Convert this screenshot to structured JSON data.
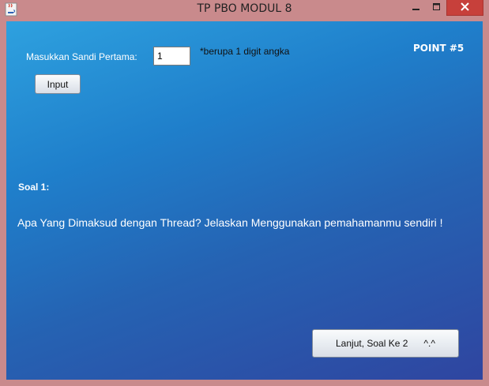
{
  "window": {
    "title": "TP PBO MODUL 8",
    "app_icon": "java-cup-icon",
    "controls": {
      "minimize_icon": "minimize-icon",
      "maximize_icon": "maximize-icon",
      "close_icon": "close-icon"
    },
    "close_color": "#c7403b"
  },
  "form": {
    "prompt_label": "Masukkan Sandi Pertama:",
    "sandi_value": "1",
    "hint": "*berupa 1 digit angka",
    "point_label": "POINT #5",
    "input_button": "Input"
  },
  "question": {
    "heading": "Soal 1:",
    "text": "Apa Yang Dimaksud dengan Thread? Jelaskan Menggunakan pemahamanmu sendiri !"
  },
  "navigation": {
    "next_label": "Lanjut, Soal Ke 2",
    "next_emoticon": "^.^"
  },
  "colors": {
    "frame": "#c98a8c",
    "panel_gradient_start": "#2ea1df",
    "panel_gradient_end": "#2f45a0",
    "text": "#ffffff"
  }
}
